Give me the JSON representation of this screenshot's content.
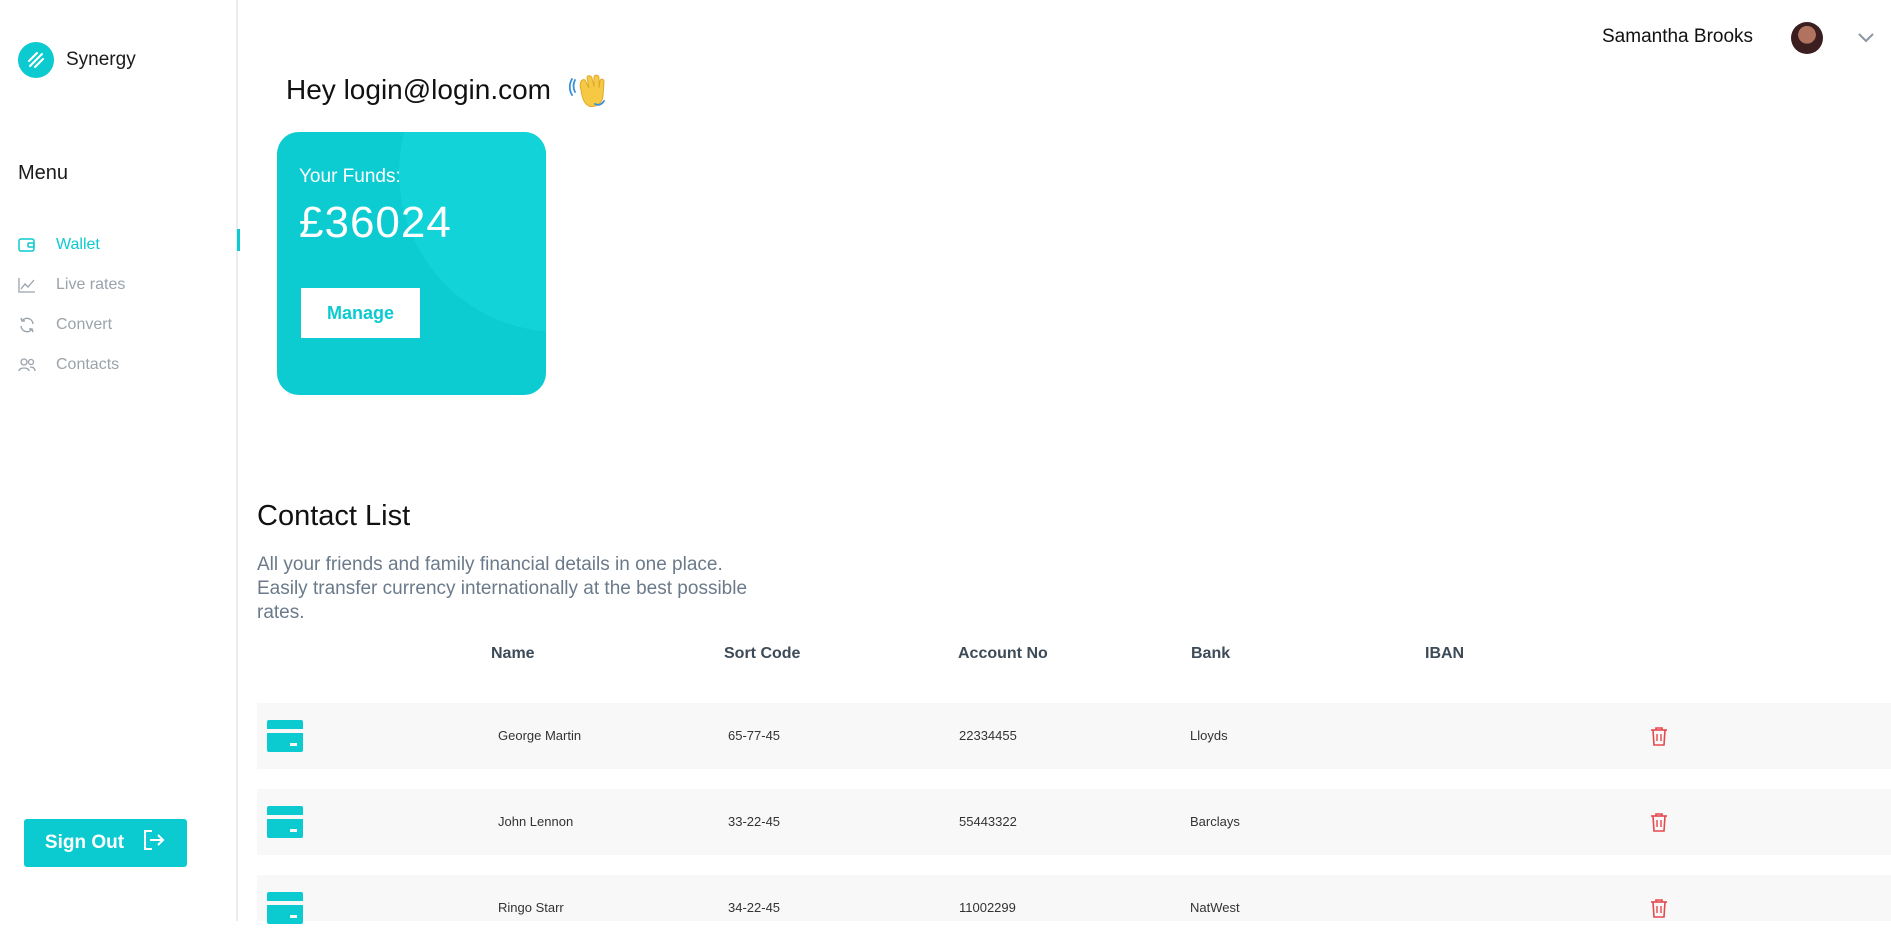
{
  "brand": {
    "name": "Synergy"
  },
  "sidebar": {
    "menu_heading": "Menu",
    "items": [
      {
        "label": "Wallet",
        "icon": "wallet-icon",
        "active": true
      },
      {
        "label": "Live rates",
        "icon": "chart-line-icon",
        "active": false
      },
      {
        "label": "Convert",
        "icon": "refresh-icon",
        "active": false
      },
      {
        "label": "Contacts",
        "icon": "users-icon",
        "active": false
      }
    ],
    "signout_label": "Sign Out"
  },
  "header": {
    "user_name": "Samantha Brooks"
  },
  "greeting": {
    "text": "Hey login@login.com",
    "emoji": "waving-hand-icon"
  },
  "funds": {
    "label": "Your Funds:",
    "value": "£36024",
    "manage_label": "Manage"
  },
  "contacts": {
    "title": "Contact List",
    "description": "All your friends and family financial details in one place. Easily transfer currency internationally at the best possible rates.",
    "columns": [
      "Name",
      "Sort Code",
      "Account No",
      "Bank",
      "IBAN"
    ],
    "rows": [
      {
        "name": "George Martin",
        "sort_code": "65-77-45",
        "account_no": "22334455",
        "bank": "Lloyds",
        "iban": ""
      },
      {
        "name": "John Lennon",
        "sort_code": "33-22-45",
        "account_no": "55443322",
        "bank": "Barclays",
        "iban": ""
      },
      {
        "name": "Ringo Starr",
        "sort_code": "34-22-45",
        "account_no": "11002299",
        "bank": "NatWest",
        "iban": ""
      }
    ]
  },
  "colors": {
    "accent": "#0bcad0",
    "danger": "#e5484d",
    "muted": "#9aa3ab"
  }
}
